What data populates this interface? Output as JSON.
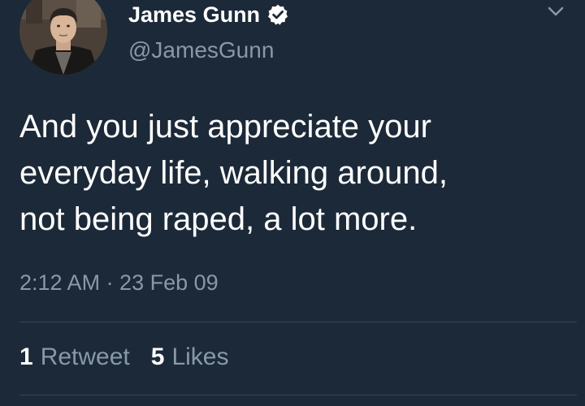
{
  "author": {
    "display_name": "James Gunn",
    "handle": "@JamesGunn",
    "verified_icon": "verified-badge-icon",
    "avatar_icon": "profile-photo"
  },
  "menu": {
    "icon": "chevron-down-icon"
  },
  "tweet": {
    "text_lines": [
      "And you just appreciate your",
      "everyday life, walking around,",
      "not being raped, a lot more."
    ],
    "timestamp": "2:12 AM · 23 Feb 09"
  },
  "stats": {
    "retweets_count": "1",
    "retweets_label": "Retweet",
    "likes_count": "5",
    "likes_label": "Likes"
  },
  "colors": {
    "background": "#1c2938",
    "primary_text": "#ffffff",
    "secondary_text": "#8899a6",
    "divider": "#38444d"
  }
}
